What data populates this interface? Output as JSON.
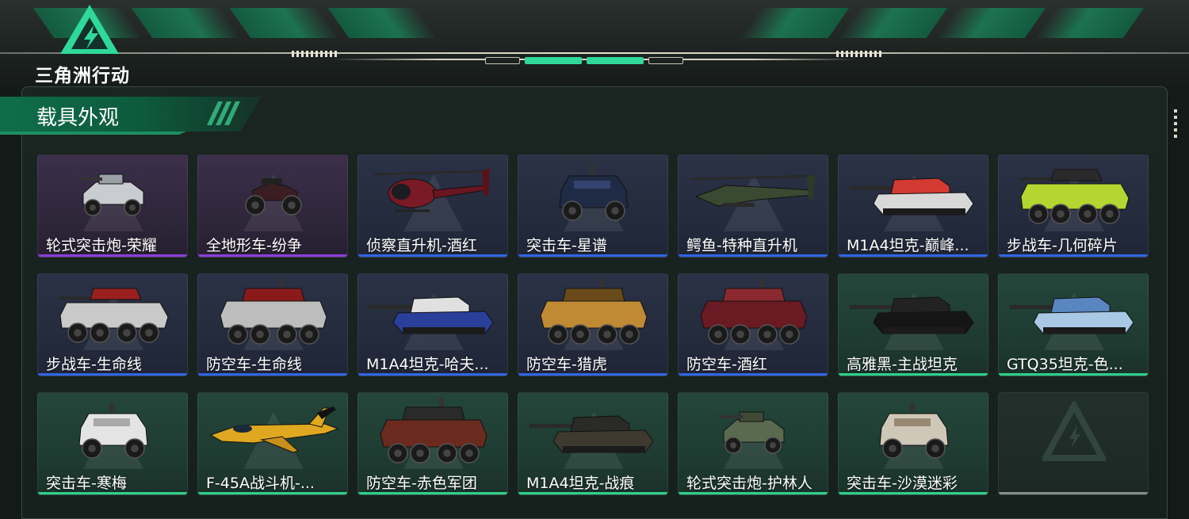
{
  "header": {
    "logo_text": "三角洲行动",
    "accent_color": "#2fd99a"
  },
  "section": {
    "title": "载具外观"
  },
  "vehicles": [
    {
      "label": "轮式突击炮-荣耀",
      "rarity": "purple",
      "icon": "wheeled-assault-gun-icon"
    },
    {
      "label": "全地形车-纷争",
      "rarity": "purple",
      "icon": "atv-icon"
    },
    {
      "label": "侦察直升机-酒红",
      "rarity": "blue",
      "icon": "scout-helicopter-icon"
    },
    {
      "label": "突击车-星谱",
      "rarity": "blue",
      "icon": "assault-vehicle-icon"
    },
    {
      "label": "鳄鱼-特种直升机",
      "rarity": "blue",
      "icon": "attack-helicopter-icon"
    },
    {
      "label": "M1A4坦克-巅峰...",
      "rarity": "blue",
      "icon": "tank-icon"
    },
    {
      "label": "步战车-几何碎片",
      "rarity": "blue",
      "icon": "ifv-icon"
    },
    {
      "label": "步战车-生命线",
      "rarity": "blue",
      "icon": "ifv-icon"
    },
    {
      "label": "防空车-生命线",
      "rarity": "blue",
      "icon": "aa-vehicle-icon"
    },
    {
      "label": "M1A4坦克-哈夫...",
      "rarity": "blue",
      "icon": "tank-icon"
    },
    {
      "label": "防空车-猎虎",
      "rarity": "blue",
      "icon": "aa-vehicle-icon"
    },
    {
      "label": "防空车-酒红",
      "rarity": "blue",
      "icon": "aa-vehicle-icon"
    },
    {
      "label": "高雅黑-主战坦克",
      "rarity": "green",
      "icon": "tank-icon"
    },
    {
      "label": "GTQ35坦克-色...",
      "rarity": "green",
      "icon": "tank-icon"
    },
    {
      "label": "突击车-寒梅",
      "rarity": "green",
      "icon": "assault-vehicle-icon"
    },
    {
      "label": "F-45A战斗机-...",
      "rarity": "green",
      "icon": "fighter-jet-icon"
    },
    {
      "label": "防空车-赤色军团",
      "rarity": "green",
      "icon": "aa-vehicle-icon"
    },
    {
      "label": "M1A4坦克-战痕",
      "rarity": "green",
      "icon": "tank-icon"
    },
    {
      "label": "轮式突击炮-护林人",
      "rarity": "green",
      "icon": "wheeled-assault-gun-icon"
    },
    {
      "label": "突击车-沙漠迷彩",
      "rarity": "green",
      "icon": "assault-vehicle-icon"
    },
    {
      "label": "",
      "rarity": "empty",
      "icon": "empty-slot-logo-icon"
    }
  ]
}
